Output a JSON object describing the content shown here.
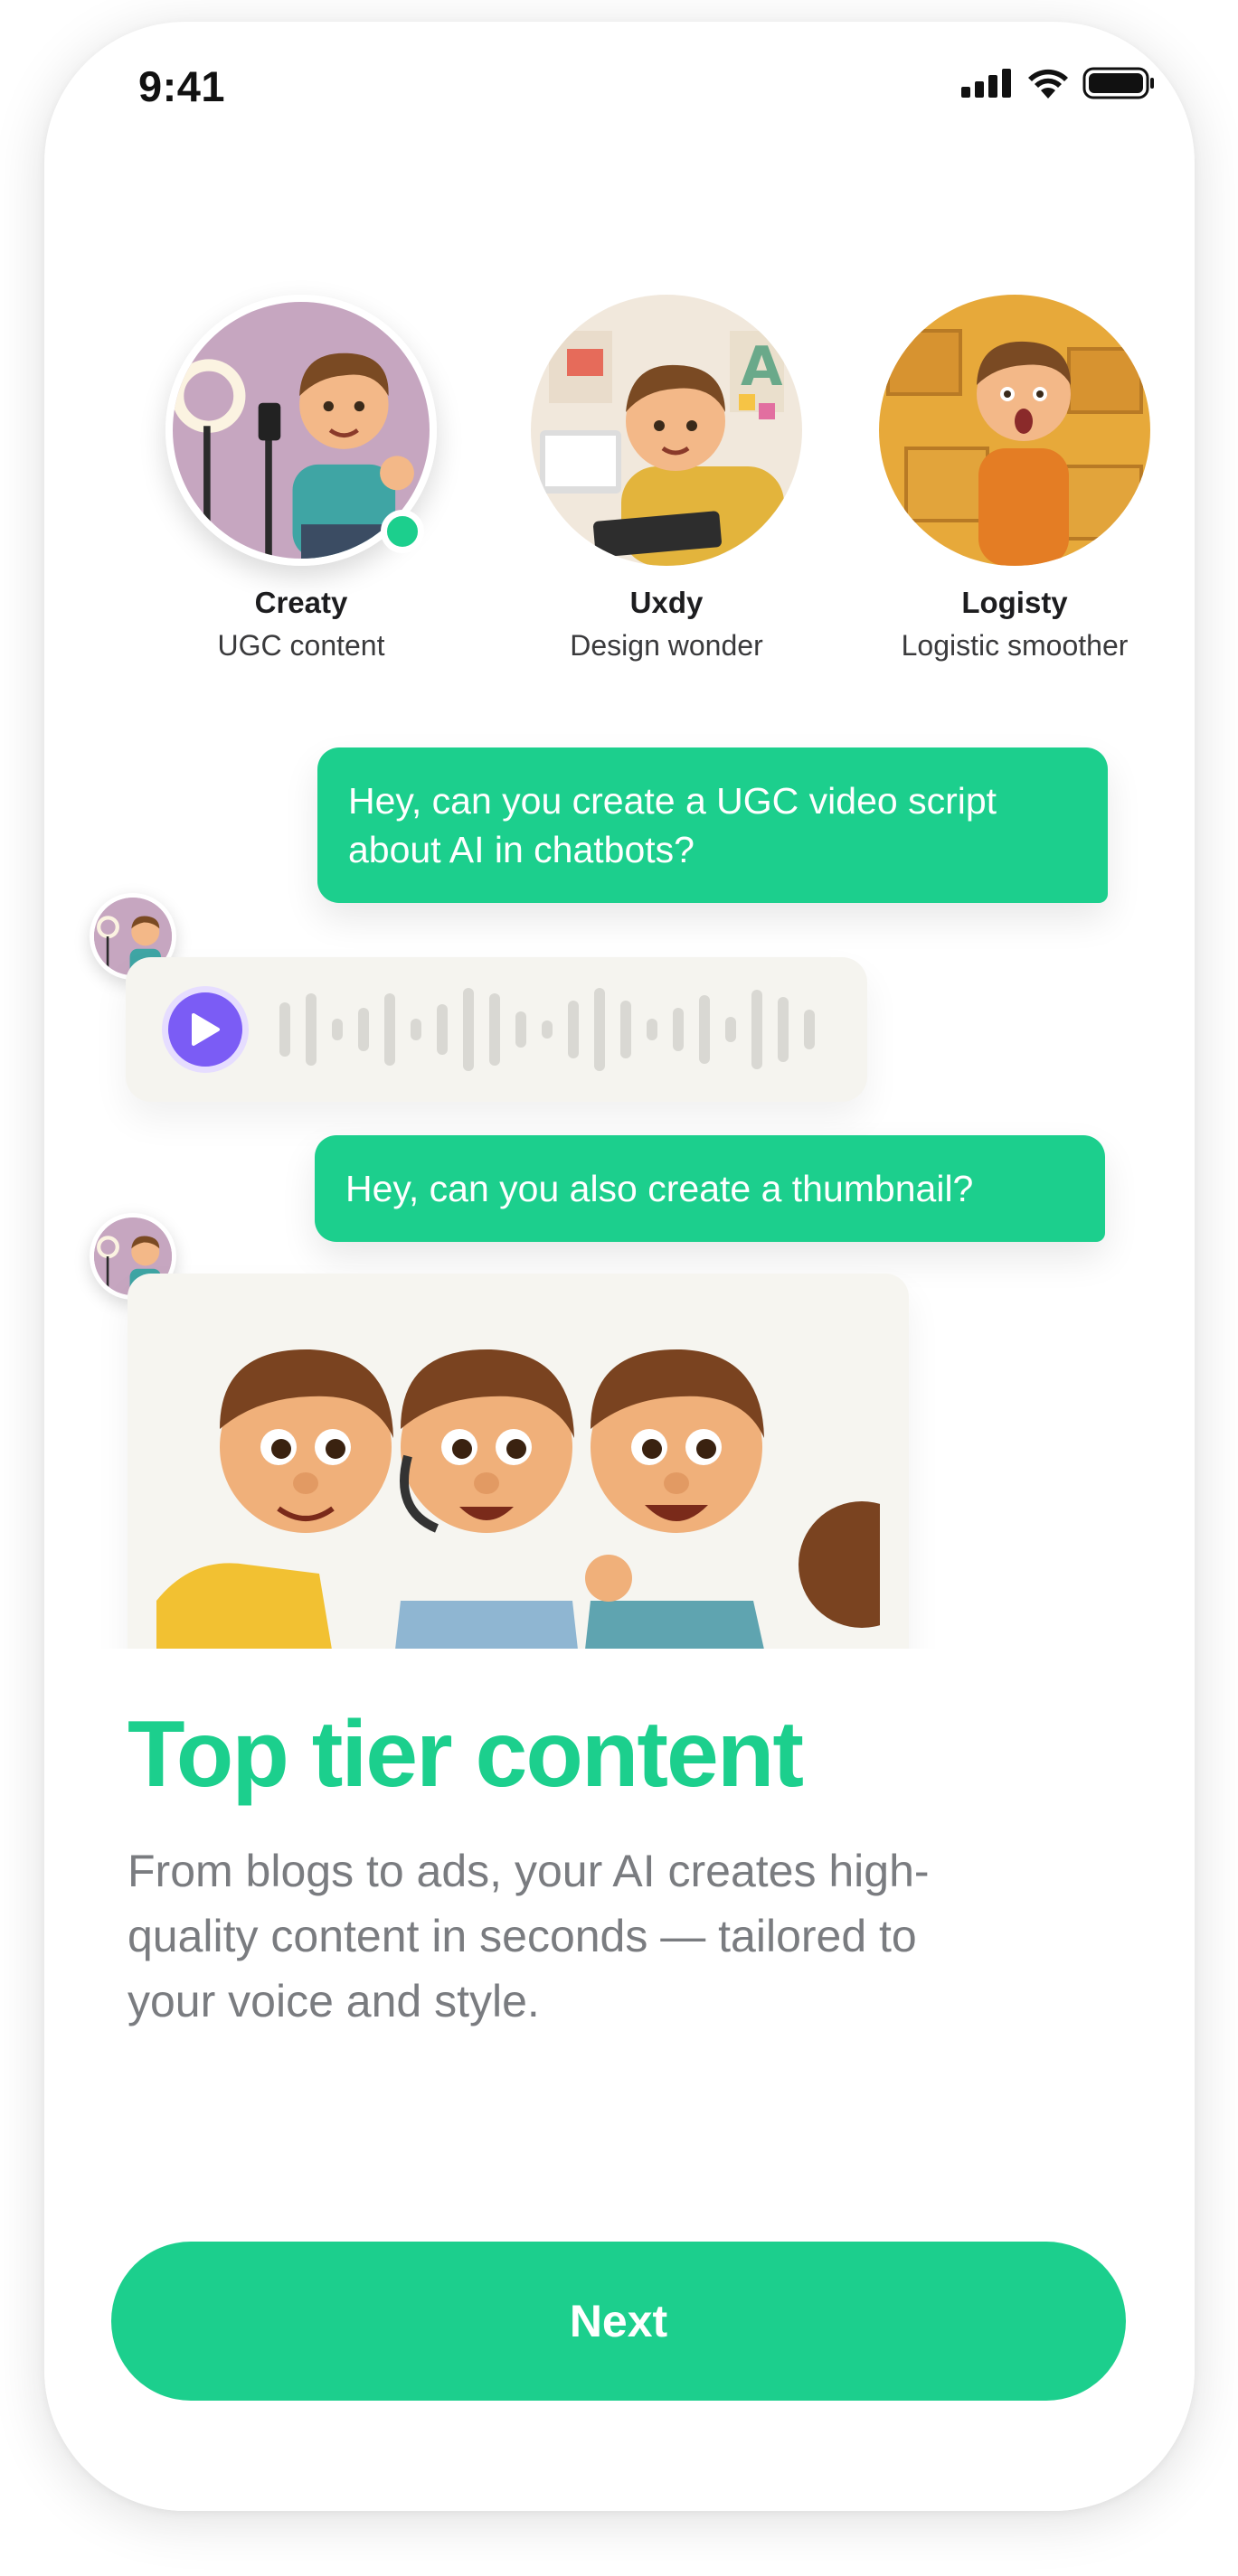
{
  "status_bar": {
    "time": "9:41",
    "icons": [
      "signal-icon",
      "wifi-icon",
      "battery-icon"
    ]
  },
  "agents": [
    {
      "name": "Creaty",
      "role": "UGC content",
      "selected": true,
      "online": true
    },
    {
      "name": "Uxdy",
      "role": "Design wonder",
      "selected": false,
      "online": false
    },
    {
      "name": "Logisty",
      "role": "Logistic smoother",
      "selected": false,
      "online": false
    }
  ],
  "chat": {
    "message_1": {
      "line1": "Hey, can you create a UGC video script",
      "line2": "about AI in chatbots?"
    },
    "voice_reply": {
      "icon": "play-icon"
    },
    "message_2": "Hey, can you also create a thumbnail?"
  },
  "onboarding": {
    "title": "Top tier content",
    "line1": "From blogs to ads, your AI creates high-",
    "line2": "quality content in seconds — tailored to",
    "line3": "your voice and style."
  },
  "next_button": "Next",
  "colors": {
    "accent": "#1ccf8d",
    "play": "#7b5cf5",
    "body_text": "#7a7c80"
  }
}
